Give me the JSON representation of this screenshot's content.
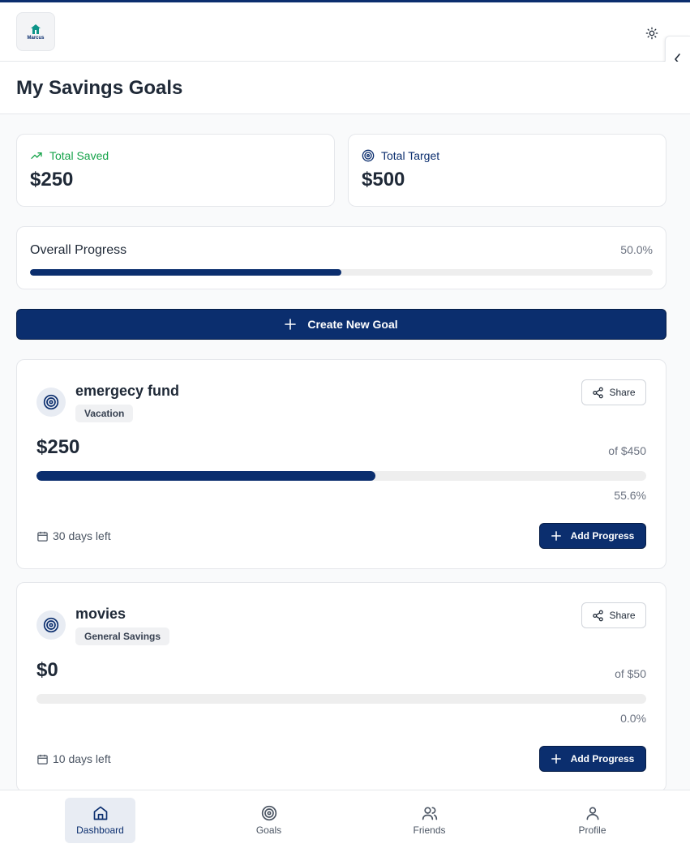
{
  "app": {
    "logo_text": "Marcus",
    "page_title": "My Savings Goals"
  },
  "colors": {
    "primary": "#0b2e6e",
    "saved_green": "#16a34a",
    "muted": "#6b7280"
  },
  "stats": {
    "total_saved_label": "Total Saved",
    "total_saved_value": "$250",
    "total_target_label": "Total Target",
    "total_target_value": "$500"
  },
  "overall": {
    "label": "Overall Progress",
    "percent_text": "50.0%",
    "fraction": 0.5
  },
  "create_button_label": "Create New Goal",
  "goals": [
    {
      "name": "emergecy fund",
      "category": "Vacation",
      "share_label": "Share",
      "amount": "$250",
      "of_target": "of $450",
      "percent_text": "55.6%",
      "fraction": 0.556,
      "days_left": "30 days left",
      "add_label": "Add Progress"
    },
    {
      "name": "movies",
      "category": "General Savings",
      "share_label": "Share",
      "amount": "$0",
      "of_target": "of $50",
      "percent_text": "0.0%",
      "fraction": 0.0,
      "days_left": "10 days left",
      "add_label": "Add Progress"
    }
  ],
  "nav": [
    {
      "label": "Dashboard",
      "icon": "home-icon",
      "active": true
    },
    {
      "label": "Goals",
      "icon": "target-icon",
      "active": false
    },
    {
      "label": "Friends",
      "icon": "users-icon",
      "active": false
    },
    {
      "label": "Profile",
      "icon": "user-icon",
      "active": false
    }
  ]
}
